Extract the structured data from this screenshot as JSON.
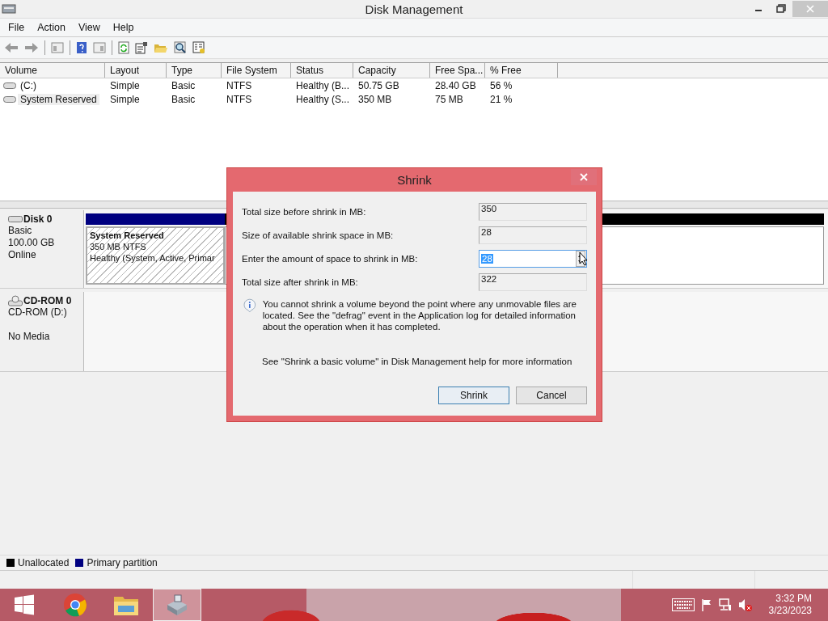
{
  "window": {
    "title": "Disk Management"
  },
  "menu": [
    "File",
    "Action",
    "View",
    "Help"
  ],
  "volume_table": {
    "columns": [
      "Volume",
      "Layout",
      "Type",
      "File System",
      "Status",
      "Capacity",
      "Free Spa...",
      "% Free"
    ],
    "rows": [
      {
        "kind": "disk",
        "selected": false,
        "cells": [
          "(C:)",
          "Simple",
          "Basic",
          "NTFS",
          "Healthy (B...",
          "50.75 GB",
          "28.40 GB",
          "56 %"
        ]
      },
      {
        "kind": "disk",
        "selected": true,
        "cells": [
          "System Reserved",
          "Simple",
          "Basic",
          "NTFS",
          "Healthy (S...",
          "350 MB",
          "75 MB",
          "21 %"
        ]
      }
    ]
  },
  "disks": [
    {
      "kind": "disk",
      "name": "Disk 0",
      "type": "Basic",
      "size": "100.00 GB",
      "status": "Online",
      "partitions": [
        {
          "kind": "primary",
          "color": "#000080",
          "label": "System Reserved",
          "detail": "350 MB NTFS",
          "status": "Healthy (System, Active, Primar"
        },
        {
          "kind": "unallocated",
          "color": "#000000"
        }
      ]
    },
    {
      "kind": "cdrom",
      "name": "CD-ROM 0",
      "type": "CD-ROM (D:)",
      "status": "No Media"
    }
  ],
  "legend": [
    {
      "label": "Unallocated",
      "color": "#000000"
    },
    {
      "label": "Primary partition",
      "color": "#000080"
    }
  ],
  "dialog": {
    "title": "Shrink",
    "fields": [
      {
        "kind": "readonly",
        "label": "Total size before shrink in MB:",
        "value": "350"
      },
      {
        "kind": "readonly",
        "label": "Size of available shrink space in MB:",
        "value": "28"
      },
      {
        "kind": "spin",
        "label": "Enter the amount of space to shrink in MB:",
        "value": "28",
        "selected": true
      },
      {
        "kind": "readonly",
        "label": "Total size after shrink in MB:",
        "value": "322"
      }
    ],
    "note": "You cannot shrink a volume beyond the point where any unmovable files are located. See the \"defrag\" event in the Application log for detailed information about the operation when it has completed.",
    "help": "See \"Shrink a basic volume\" in Disk Management help for more information",
    "buttons": [
      {
        "label": "Shrink",
        "default": true
      },
      {
        "label": "Cancel",
        "default": false
      }
    ]
  },
  "taskbar": {
    "apps": [
      {
        "kind": "start",
        "active": false
      },
      {
        "kind": "browser",
        "active": false
      },
      {
        "kind": "explorer",
        "active": false
      },
      {
        "kind": "diskmgmt",
        "active": true
      }
    ],
    "time": "3:32 PM",
    "date": "3/23/2023"
  }
}
